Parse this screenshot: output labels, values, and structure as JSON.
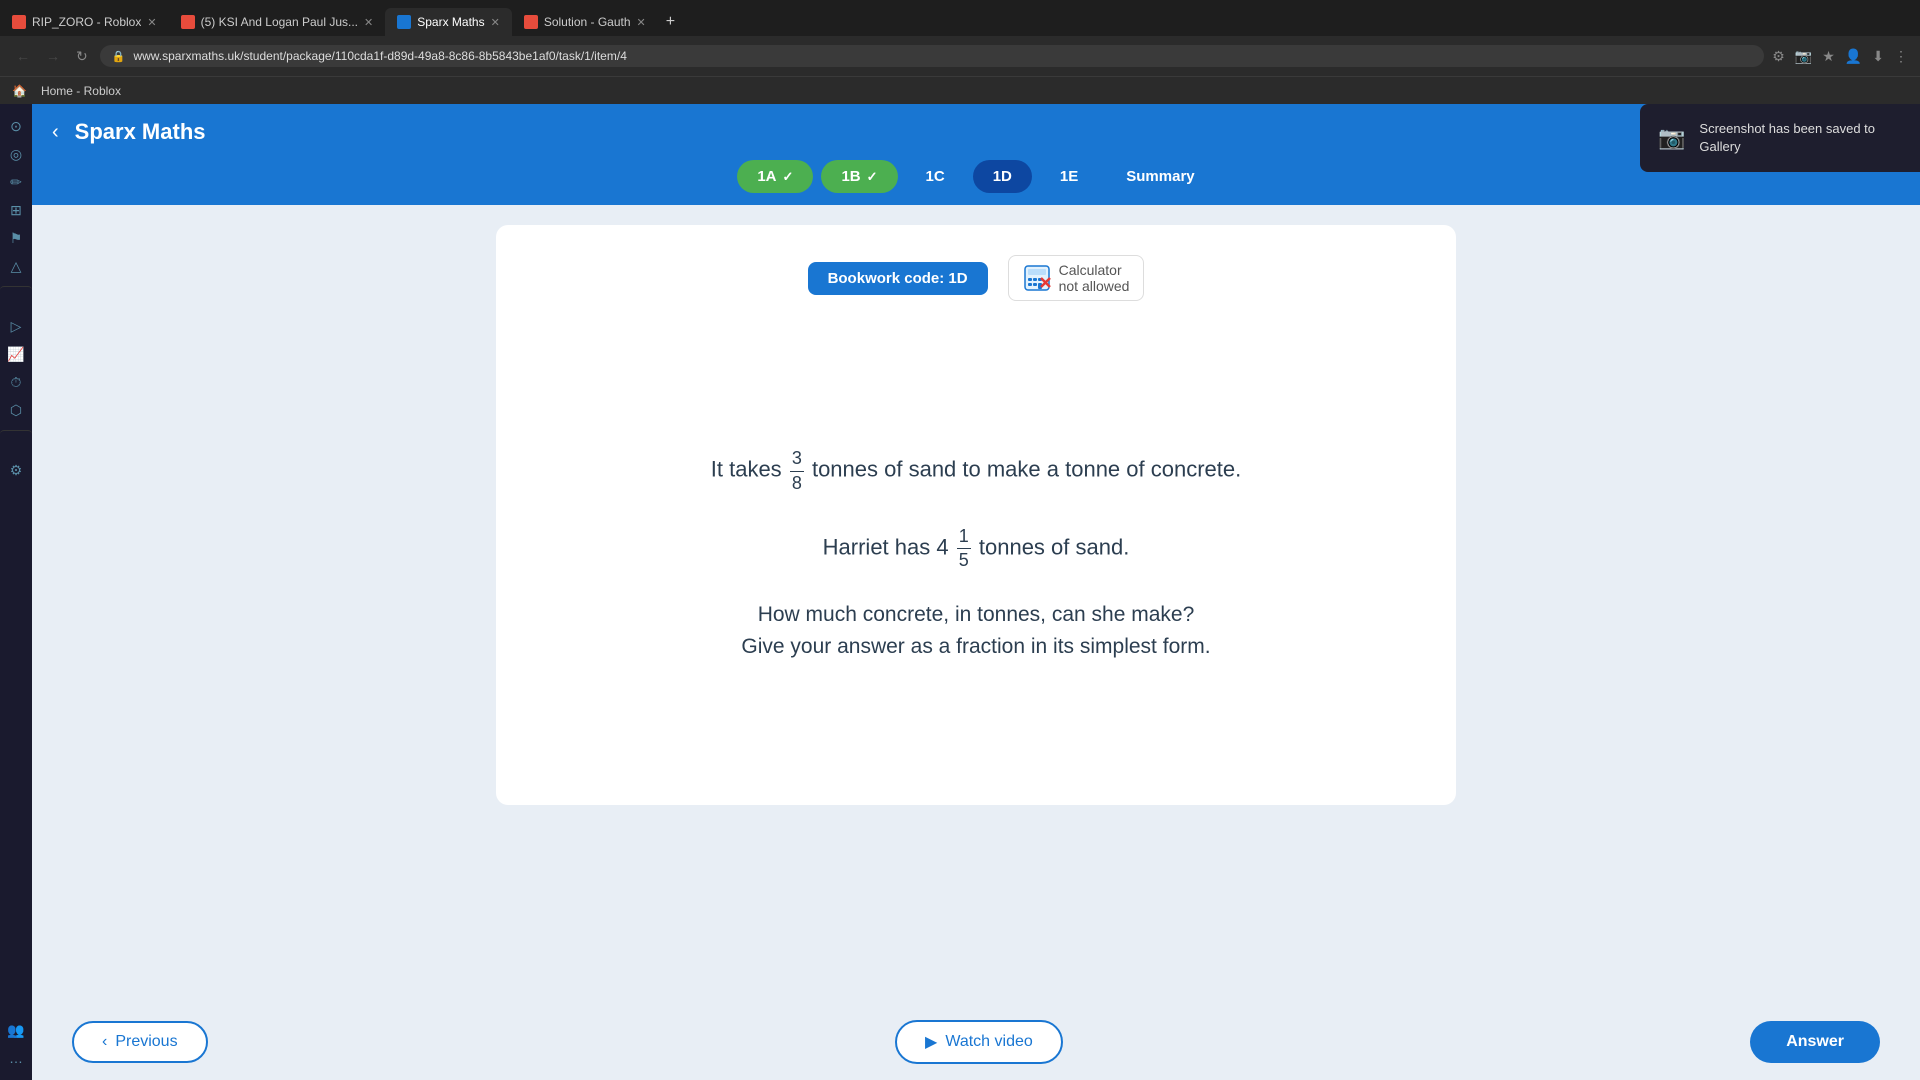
{
  "browser": {
    "tabs": [
      {
        "id": "tab1",
        "title": "RIP_ZORO - Roblox",
        "favicon_color": "#e74c3c",
        "active": false
      },
      {
        "id": "tab2",
        "title": "(5) KSI And Logan Paul Jus...",
        "favicon_color": "#e74c3c",
        "active": false
      },
      {
        "id": "tab3",
        "title": "Sparx Maths",
        "favicon_color": "#1976d2",
        "active": true
      },
      {
        "id": "tab4",
        "title": "Solution - Gauth",
        "favicon_color": "#e74c3c",
        "active": false
      }
    ],
    "address": "www.sparxmaths.uk/student/package/110cda1f-d89d-49a8-8c86-8b5843be1af0/task/1/item/4",
    "bookmark": "Home - Roblox"
  },
  "header": {
    "title": "Sparx Maths",
    "back_label": "‹"
  },
  "task_tabs": [
    {
      "id": "1A",
      "label": "1A",
      "state": "completed"
    },
    {
      "id": "1B",
      "label": "1B",
      "state": "completed"
    },
    {
      "id": "1C",
      "label": "1C",
      "state": "normal"
    },
    {
      "id": "1D",
      "label": "1D",
      "state": "active"
    },
    {
      "id": "1E",
      "label": "1E",
      "state": "normal"
    },
    {
      "id": "summary",
      "label": "Summary",
      "state": "summary"
    }
  ],
  "content": {
    "bookwork_code": "Bookwork code: 1D",
    "calculator_label": "Calculator",
    "calculator_status": "not allowed",
    "question_line1_before": "It takes",
    "fraction_num": "3",
    "fraction_den": "8",
    "question_line1_after": "tonnes of sand to make a tonne of concrete.",
    "question_line2_before": "Harriet has 4",
    "mixed_num": "1",
    "mixed_den": "5",
    "question_line2_after": "tonnes of sand.",
    "question_line3": "How much concrete, in tonnes, can she make?",
    "question_line4": "Give your answer as a fraction in its simplest form."
  },
  "buttons": {
    "previous": "Previous",
    "watch_video": "Watch video",
    "answer": "Answer"
  },
  "toast": {
    "text": "Screenshot has been saved to Gallery"
  }
}
